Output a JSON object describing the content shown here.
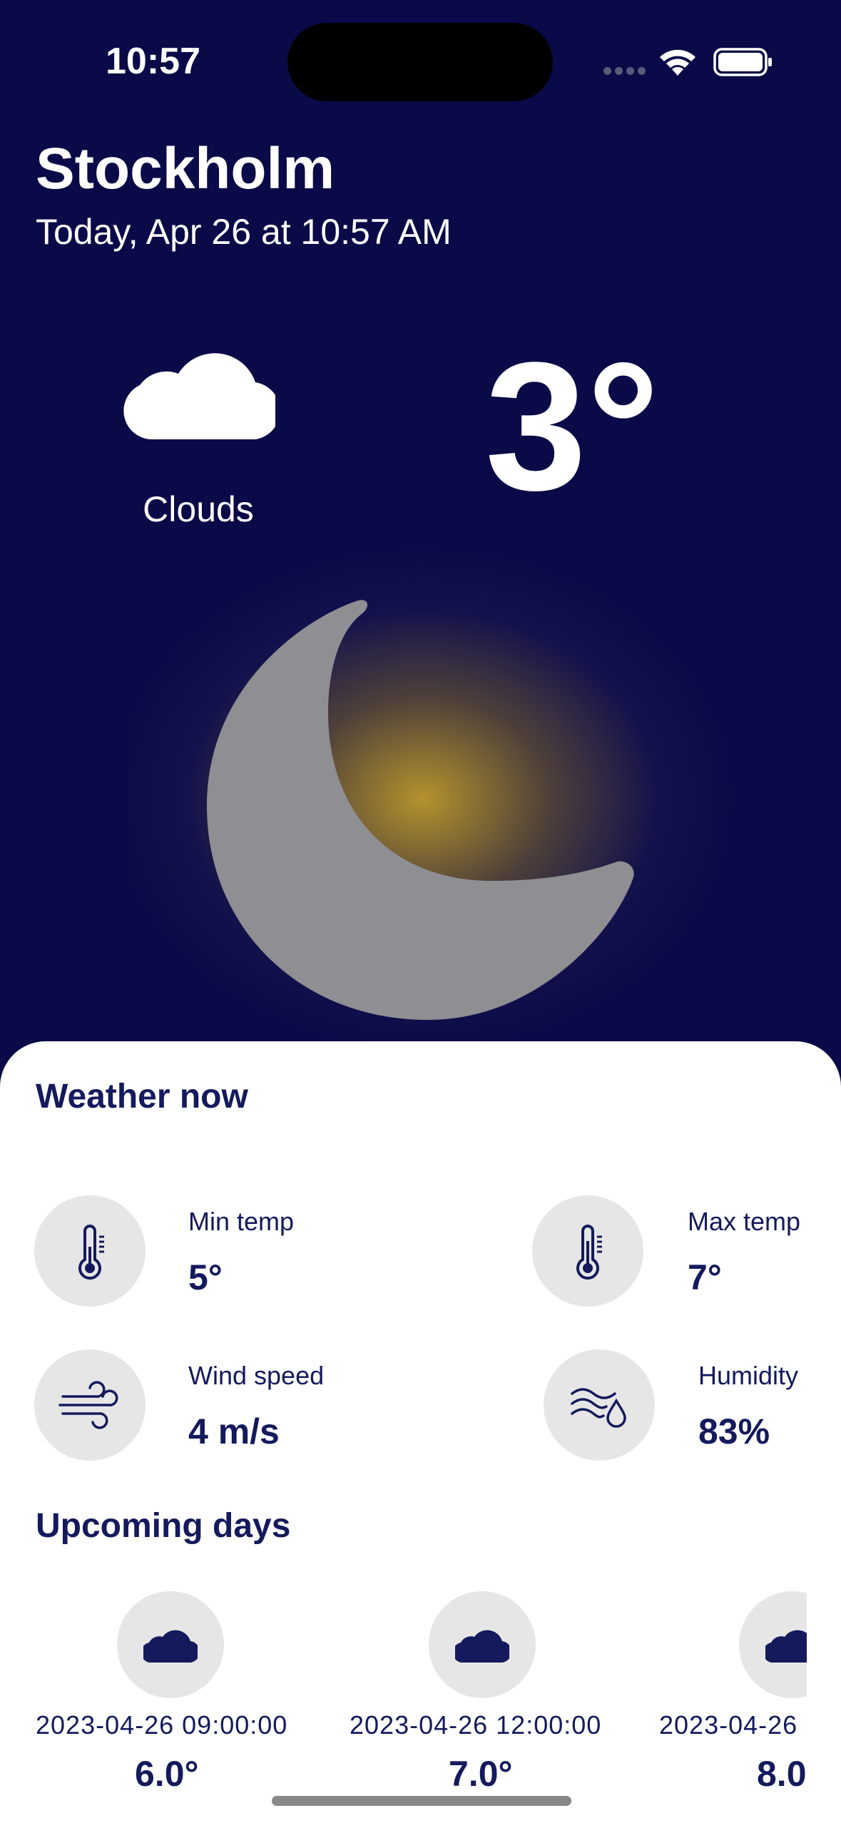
{
  "status_bar": {
    "time": "10:57"
  },
  "header": {
    "city": "Stockholm",
    "date": "Today, Apr 26 at 10:57 AM"
  },
  "current": {
    "condition": "Clouds",
    "condition_icon": "cloud-icon",
    "temperature": "3°",
    "illustration": "moon-icon"
  },
  "weather_now": {
    "title": "Weather now",
    "min_temp": {
      "label": "Min temp",
      "value": "5°",
      "icon": "thermometer-icon"
    },
    "max_temp": {
      "label": "Max temp",
      "value": "7°",
      "icon": "thermometer-icon"
    },
    "wind_speed": {
      "label": "Wind speed",
      "value": "4 m/s",
      "icon": "wind-icon"
    },
    "humidity": {
      "label": "Humidity",
      "value": "83%",
      "icon": "humidity-icon"
    }
  },
  "upcoming": {
    "title": "Upcoming days",
    "days": [
      {
        "time": "2023-04-26 09:00:00",
        "temp": "6.0°",
        "icon": "cloud-icon"
      },
      {
        "time": "2023-04-26 12:00:00",
        "temp": "7.0°",
        "icon": "cloud-icon"
      },
      {
        "time": "2023-04-26",
        "temp": "8.0",
        "icon": "cloud-icon"
      }
    ]
  },
  "colors": {
    "background": "#0a0a48",
    "accent_text": "#141a5c",
    "moon": "#8e8e93",
    "glow": "#c9a227",
    "circle_bg": "#e6e6e6"
  }
}
